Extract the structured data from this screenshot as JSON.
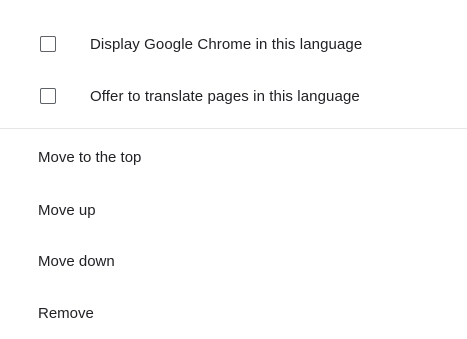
{
  "language_menu": {
    "checkbox_items": [
      {
        "label": "Display Google Chrome in this language",
        "checked": false
      },
      {
        "label": "Offer to translate pages in this language",
        "checked": false
      }
    ],
    "actions": [
      {
        "label": "Move to the top"
      },
      {
        "label": "Move up"
      },
      {
        "label": "Move down"
      },
      {
        "label": "Remove"
      }
    ]
  }
}
